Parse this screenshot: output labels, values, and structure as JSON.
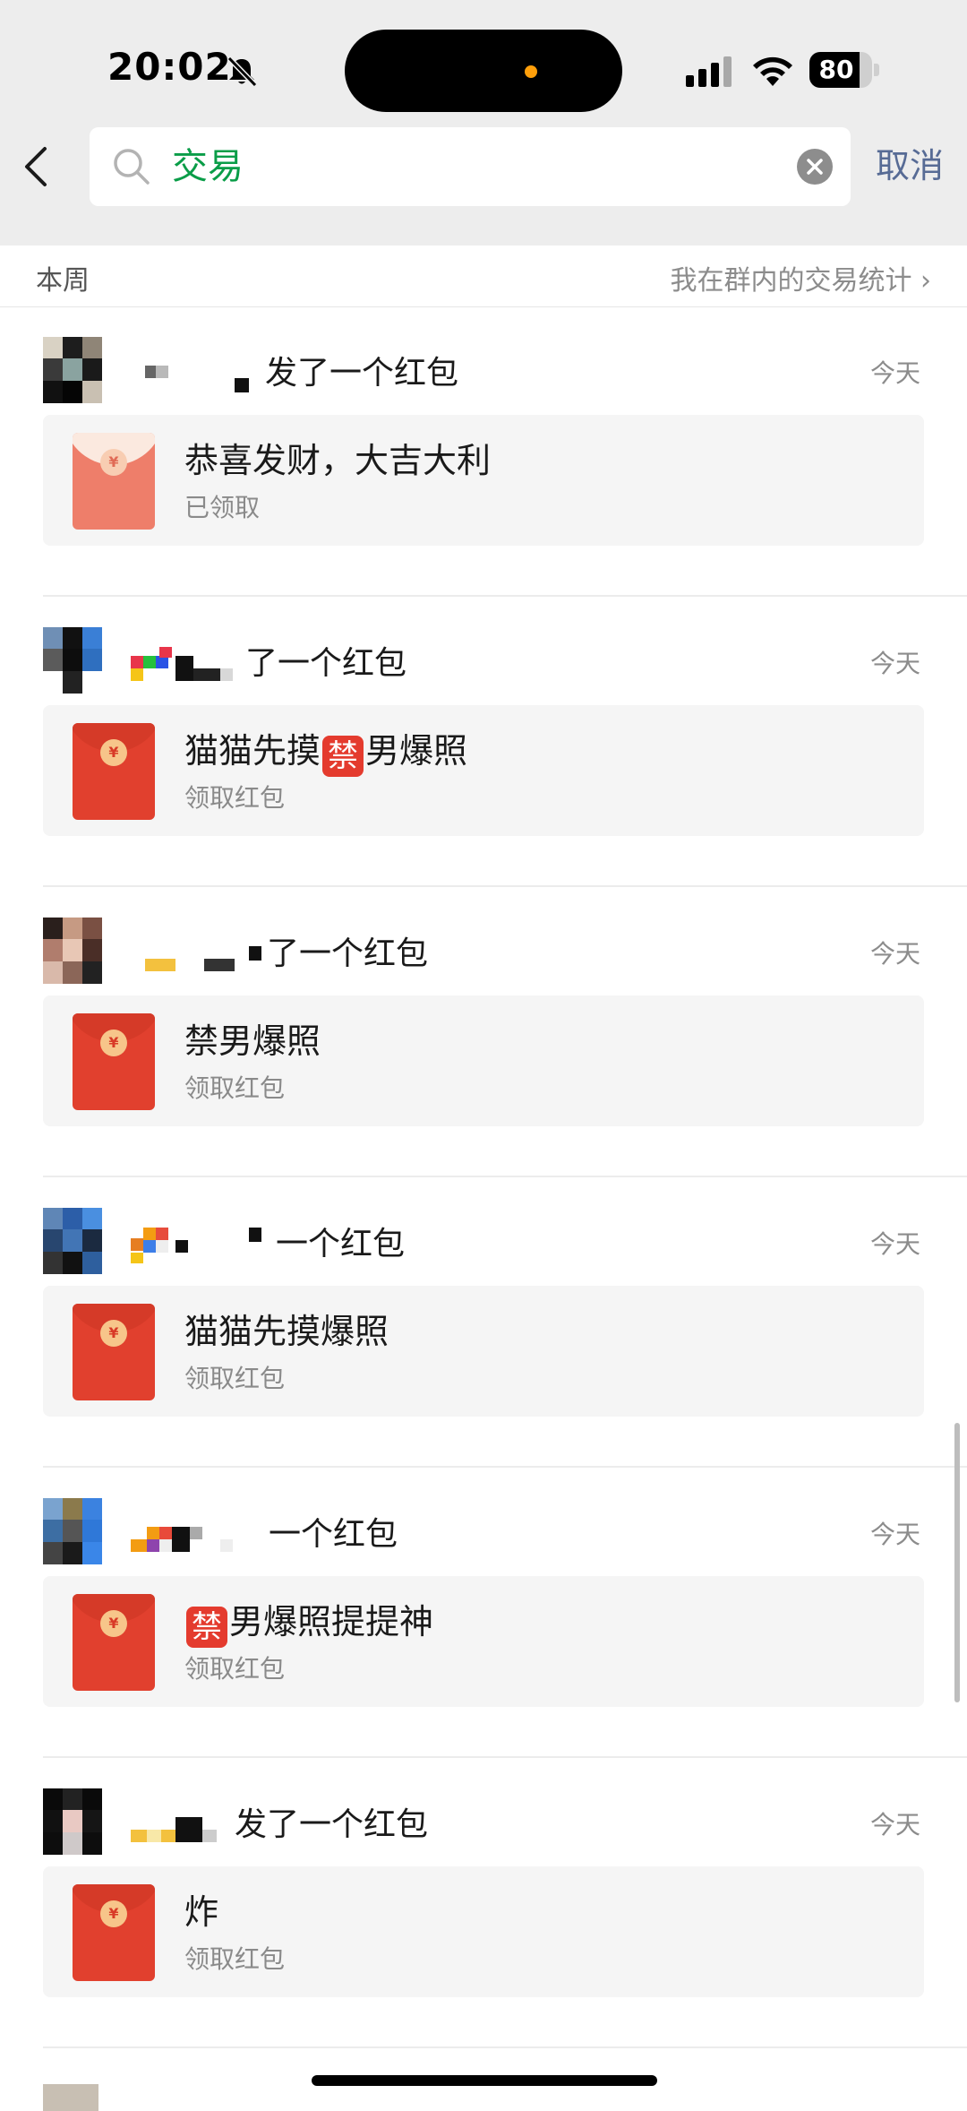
{
  "status_bar": {
    "time": "20:02",
    "battery": "80",
    "battery_level": 0.8
  },
  "search": {
    "query": "交易",
    "cancel_label": "取消"
  },
  "section": {
    "week_label": "本周",
    "stats_link": "我在群内的交易统计 ›"
  },
  "items": [
    {
      "title": "发了一个红包",
      "time": "今天",
      "card_title_parts": [
        "恭喜发财，大吉大利"
      ],
      "card_sub": "已领取",
      "opened": true
    },
    {
      "title": "了一个红包",
      "time": "今天",
      "card_title_parts": [
        "猫猫先摸",
        "禁",
        "男爆照"
      ],
      "card_sub": "领取红包",
      "opened": false
    },
    {
      "title": "了一个红包",
      "time": "今天",
      "card_title_parts": [
        "禁男爆照"
      ],
      "card_sub": "领取红包",
      "opened": false
    },
    {
      "title": "一个红包",
      "time": "今天",
      "card_title_parts": [
        "猫猫先摸爆照"
      ],
      "card_sub": "领取红包",
      "opened": false
    },
    {
      "title": "一个红包",
      "time": "今天",
      "card_title_parts": [
        "",
        "禁",
        "男爆照提提神"
      ],
      "card_sub": "领取红包",
      "opened": false
    },
    {
      "title": "发了一个红包",
      "time": "今天",
      "card_title_parts": [
        "炸"
      ],
      "card_sub": "领取红包",
      "opened": false
    }
  ],
  "colors": {
    "accent_green": "#0a9d48",
    "link_blue": "#576b95",
    "packet_red": "#e1402e"
  }
}
